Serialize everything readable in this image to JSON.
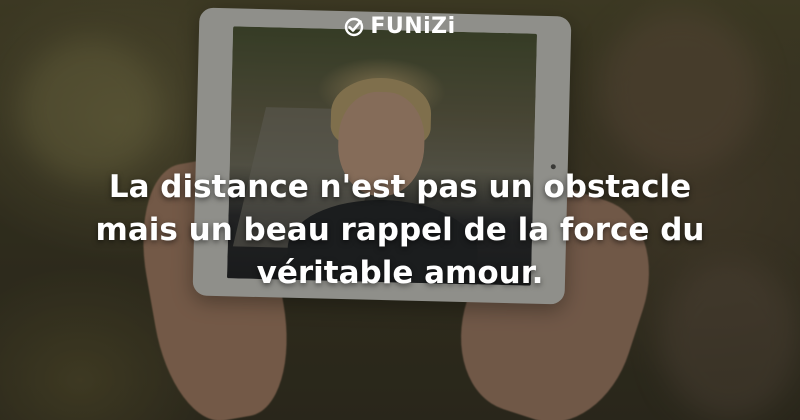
{
  "logo": {
    "text": "FUNiZi",
    "icon": "check-circle-icon"
  },
  "quote": {
    "lines": [
      "La distance n'est pas un obstacle",
      "mais un beau rappel de la force du",
      "véritable amour."
    ]
  },
  "colors": {
    "text": "#ffffff"
  }
}
